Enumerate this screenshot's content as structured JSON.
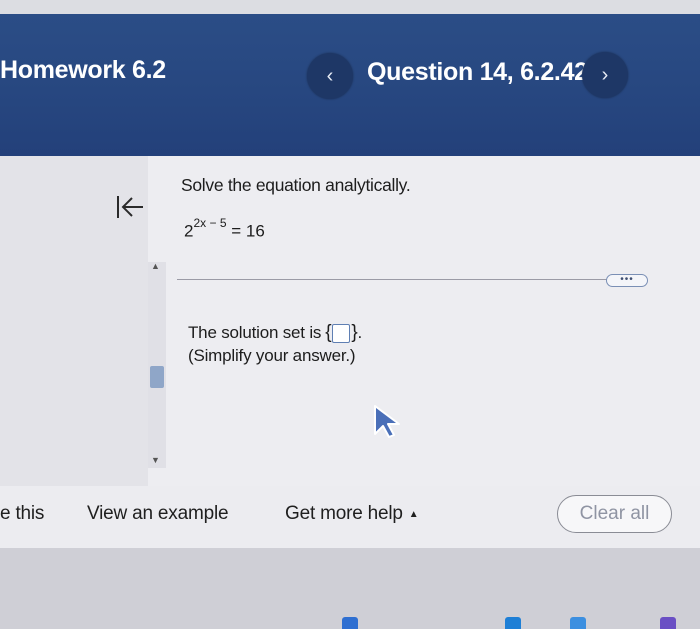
{
  "header": {
    "assignment_title": "Homework 6.2",
    "question_title": "Question 14, 6.2.42",
    "prev_glyph": "‹",
    "next_glyph": "›"
  },
  "question": {
    "prompt": "Solve the equation analytically.",
    "equation_base": "2",
    "equation_exponent": "2x − 5",
    "equation_rhs": "= 16",
    "more_label": "•••"
  },
  "answer": {
    "solution_prefix": "The solution set is",
    "open_brace": "{",
    "close_brace": "}",
    "period": ".",
    "hint": "(Simplify your answer.)"
  },
  "footer": {
    "save_label": "e this",
    "example_label": "View an example",
    "help_label": "Get more help",
    "help_caret": "▲",
    "clear_label": "Clear all"
  },
  "colors": {
    "header_bg": "#274780",
    "nav_button_bg": "#1e3766",
    "answer_box_border": "#5f7fb3"
  },
  "icons": [
    "collapse-left-icon",
    "chevron-left-icon",
    "chevron-right-icon",
    "mouse-pointer-icon",
    "scroll-up-arrow-icon",
    "scroll-down-arrow-icon"
  ]
}
